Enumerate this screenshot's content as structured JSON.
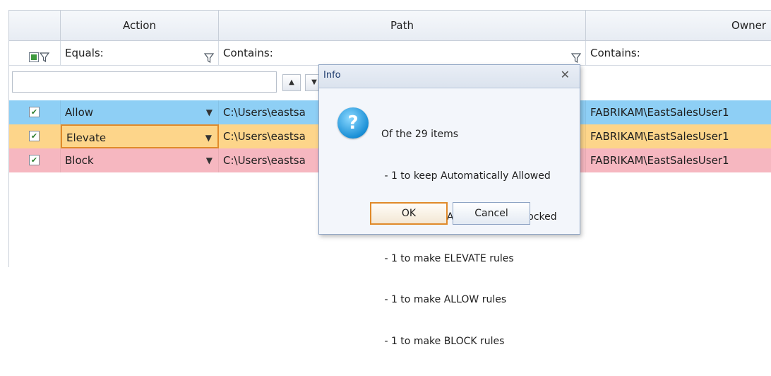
{
  "grid": {
    "headers": {
      "select": "",
      "action": "Action",
      "path": "Path",
      "owner": "Owner"
    },
    "filters": {
      "action": "Equals:",
      "path": "Contains:",
      "owner": "Contains:"
    },
    "search": {
      "value": "",
      "up": "▲",
      "down": "▼"
    },
    "rows": [
      {
        "checked": "✔",
        "action": "Allow",
        "path": "C:\\Users\\eastsa",
        "owner": "FABRIKAM\\EastSalesUser1",
        "color": "#8ecff5"
      },
      {
        "checked": "✔",
        "action": "Elevate",
        "path": "C:\\Users\\eastsa",
        "owner": "FABRIKAM\\EastSalesUser1",
        "color": "#fdd58a"
      },
      {
        "checked": "✔",
        "action": "Block",
        "path": "C:\\Users\\eastsa",
        "owner": "FABRIKAM\\EastSalesUser1",
        "color": "#f6b7c0"
      }
    ]
  },
  "dialog": {
    "title": "Info",
    "close": "✕",
    "icon": "question-icon",
    "icon_glyph": "?",
    "lines": [
      "Of the 29 items",
      " - 1 to keep Automatically Allowed",
      " - 25 to keep Automatically Blocked",
      " - 1 to make ELEVATE rules",
      " - 1 to make ALLOW rules",
      " - 1 to make BLOCK rules"
    ],
    "ok_label": "OK",
    "cancel_label": "Cancel"
  }
}
